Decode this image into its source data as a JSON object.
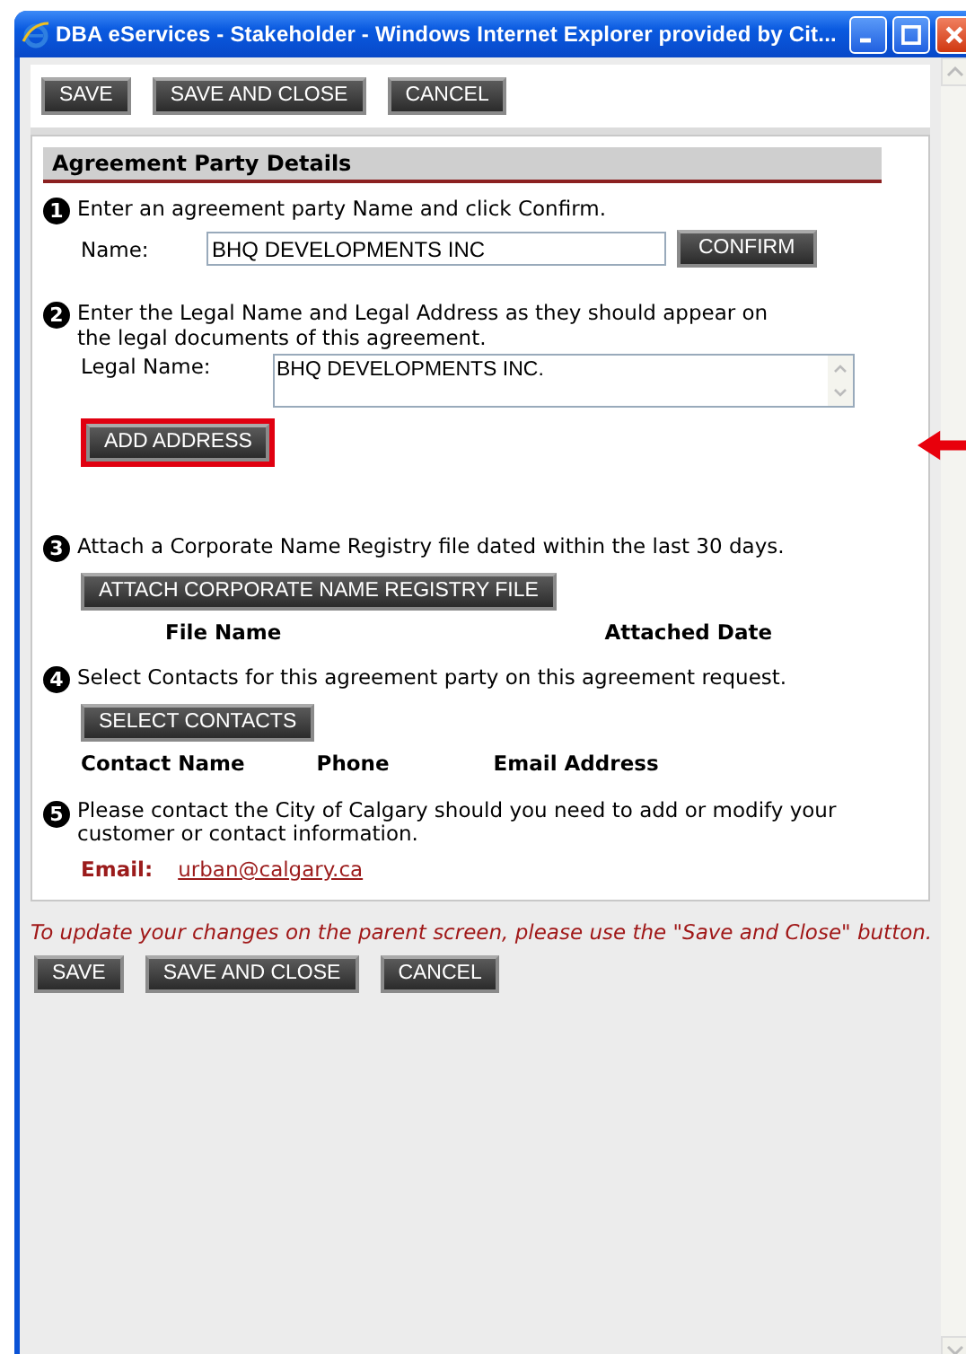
{
  "window": {
    "title": "DBA eServices - Stakeholder - Windows Internet Explorer provided by Cit..."
  },
  "toolbar_top": [
    "SAVE",
    "SAVE AND CLOSE",
    "CANCEL"
  ],
  "section": {
    "title": "Agreement Party Details",
    "name_step": {
      "number": "1",
      "text": "Enter an agreement party Name and click Confirm.",
      "label": "Name:",
      "value": "BHQ DEVELOPMENTS INC",
      "button": "CONFIRM"
    },
    "legal_step": {
      "number": "2",
      "text": "Enter the Legal Name and Legal Address as they should appear on the legal documents of this agreement.",
      "label": "Legal Name:",
      "value": "BHQ DEVELOPMENTS INC.",
      "button": "ADD ADDRESS",
      "highlighted": true
    },
    "attach_step": {
      "number": "3",
      "text": "Attach a Corporate Name Registry file dated within the last 30 days.",
      "button": "ATTACH CORPORATE NAME REGISTRY FILE",
      "columns": [
        "File Name",
        "Attached Date"
      ]
    },
    "contacts_step": {
      "number": "4",
      "text": "Select Contacts for this agreement party on this agreement request.",
      "button": "SELECT CONTACTS",
      "columns": [
        "Contact Name",
        "Phone",
        "Email Address"
      ]
    },
    "info_step": {
      "number": "5",
      "text": "Please contact the City of Calgary should you need to add or modify your customer or contact information.",
      "email_label": "Email:",
      "email": "urban@calgary.ca"
    }
  },
  "note": "To update your changes on the parent screen, please use the \"Save and Close\" button.",
  "toolbar_bottom": [
    "SAVE",
    "SAVE AND CLOSE",
    "CANCEL"
  ]
}
